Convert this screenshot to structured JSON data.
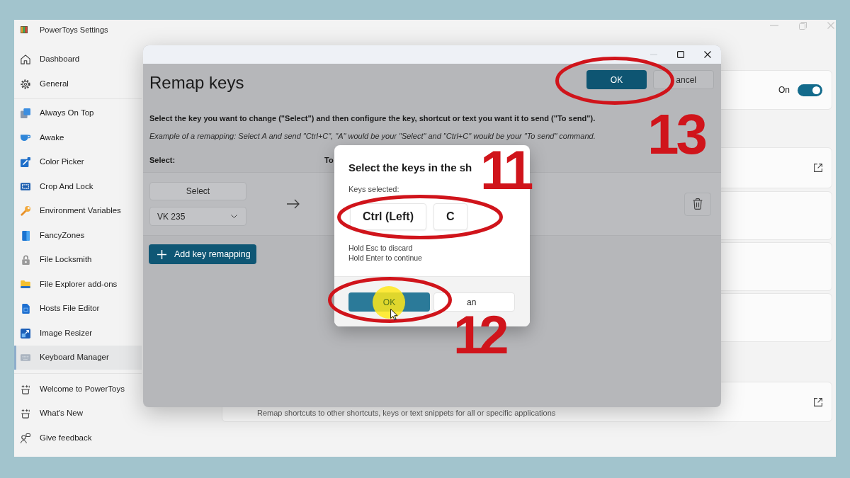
{
  "window": {
    "title": "PowerToys Settings"
  },
  "sidebar": {
    "groups": [
      {
        "items": [
          {
            "label": "Dashboard",
            "selected": false
          },
          {
            "label": "General",
            "selected": false
          }
        ]
      },
      {
        "items": [
          {
            "label": "Always On Top",
            "selected": false
          },
          {
            "label": "Awake",
            "selected": false
          },
          {
            "label": "Color Picker",
            "selected": false
          },
          {
            "label": "Crop And Lock",
            "selected": false
          },
          {
            "label": "Environment Variables",
            "selected": false
          },
          {
            "label": "FancyZones",
            "selected": false
          },
          {
            "label": "File Locksmith",
            "selected": false
          },
          {
            "label": "File Explorer add-ons",
            "selected": false
          },
          {
            "label": "Hosts File Editor",
            "selected": false
          },
          {
            "label": "Image Resizer",
            "selected": false
          },
          {
            "label": "Keyboard Manager",
            "selected": true
          }
        ]
      },
      {
        "items": [
          {
            "label": "Welcome to PowerToys",
            "selected": false
          },
          {
            "label": "What's New",
            "selected": false
          },
          {
            "label": "Give feedback",
            "selected": false
          }
        ]
      }
    ]
  },
  "settings_page": {
    "cards": [
      {
        "kind": "toggle",
        "label": "On",
        "on": true
      },
      {
        "kind": "link"
      },
      {
        "kind": "plain"
      },
      {
        "kind": "plain"
      },
      {
        "kind": "plain"
      },
      {
        "kind": "link",
        "description": "Remap shortcuts to other shortcuts, keys or text snippets for all or specific applications"
      }
    ]
  },
  "remap_dialog": {
    "title": "Remap keys",
    "buttons": [
      {
        "label": "OK",
        "kind": "primary"
      },
      {
        "label": "ancel",
        "kind": "secondary"
      }
    ],
    "instructions": "Select the key you want to change (\"Select\") and then configure the key, shortcut or text you want it to send (\"To send\").",
    "example": "Example of a remapping: Select A and send \"Ctrl+C\", \"A\" would be your \"Select\" and \"Ctrl+C\" would be your \"To send\" command.",
    "columns": [
      "Select:",
      "To"
    ],
    "rows": [
      {
        "select_label": "Select",
        "key": "VK 235"
      }
    ],
    "add_button": "Add key remapping"
  },
  "shortcut_dialog": {
    "title": "Select the keys in the sh",
    "keys_label": "Keys selected:",
    "keys": [
      "Ctrl (Left)",
      "C"
    ],
    "hints": [
      "Hold Esc to discard",
      "Hold Enter to continue"
    ],
    "buttons": [
      {
        "label": "OK",
        "kind": "primary"
      },
      {
        "label": "an",
        "kind": "secondary"
      }
    ]
  },
  "annotations": [
    {
      "number": "13"
    },
    {
      "number": "11"
    },
    {
      "number": "12"
    }
  ]
}
